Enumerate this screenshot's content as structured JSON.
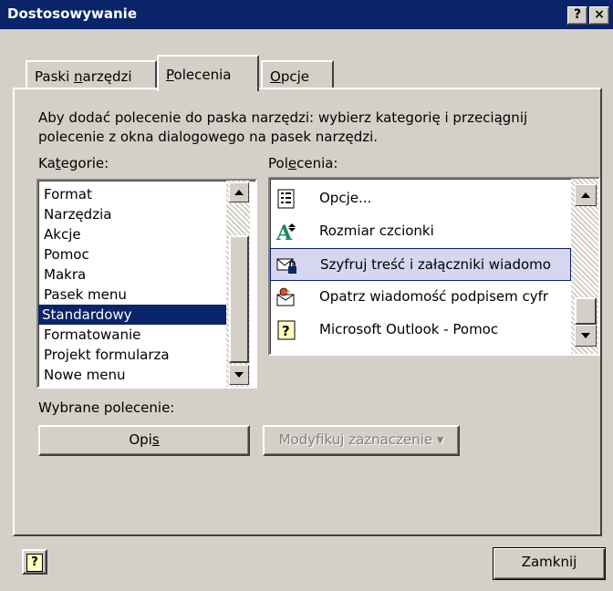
{
  "window": {
    "title": "Dostosowywanie",
    "help_glyph": "?",
    "close_glyph": "×"
  },
  "tabs": [
    {
      "pre": "Paski ",
      "ul": "n",
      "post": "arzędzi"
    },
    {
      "pre": "",
      "ul": "P",
      "post": "olecenia",
      "active": true
    },
    {
      "pre": "",
      "ul": "O",
      "post": "pcje"
    }
  ],
  "instructions": {
    "line1": "Aby dodać polecenie do paska narzędzi: wybierz kategorię i przeciągnij",
    "line2": "polecenie z okna dialogowego na pasek narzędzi."
  },
  "categories": {
    "label_pre": "Ka",
    "label_ul": "t",
    "label_post": "egorie:",
    "items": [
      "Format",
      "Narzędzia",
      "Akcje",
      "Pomoc",
      "Makra",
      "Pasek menu",
      "Standardowy",
      "Formatowanie",
      "Projekt formularza",
      "Nowe menu"
    ],
    "selected": "Standardowy"
  },
  "commands": {
    "label_pre": "Pol",
    "label_ul": "e",
    "label_post": "cenia:",
    "items": [
      {
        "label": "Opcje...",
        "icon": "options-icon"
      },
      {
        "label": "Rozmiar czcionki",
        "icon": "font-size-icon"
      },
      {
        "label": "Szyfruj treść i załączniki wiadomo",
        "icon": "encrypt-message-icon"
      },
      {
        "label": "Opatrz wiadomość podpisem cyfr",
        "icon": "digital-signature-icon"
      },
      {
        "label": "Microsoft Outlook - Pomoc",
        "icon": "help-icon"
      }
    ],
    "selected": "Szyfruj treść i załączniki wiadomo"
  },
  "selected_command": {
    "label": "Wybrane polecenie:",
    "description_pre": "Opi",
    "description_ul": "s",
    "modify_label": "Modyfikuj zaznaczenie",
    "modify_arrow": "▾"
  },
  "footer": {
    "help_glyph": "?",
    "close_label": "Zamknij"
  },
  "colors": {
    "titlebar": "#0a246a",
    "face": "#d4d0c8",
    "selection": "#0a246a"
  }
}
